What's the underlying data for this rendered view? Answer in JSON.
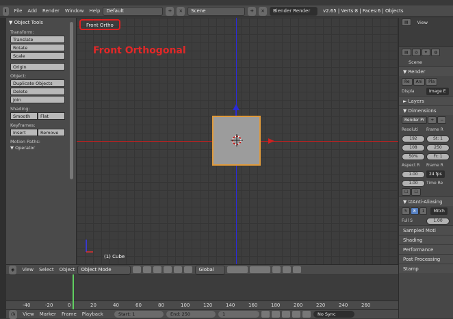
{
  "topbar": {
    "editor_icon": "ℹ",
    "menus": [
      "File",
      "Add",
      "Render",
      "Window",
      "Help"
    ],
    "layout": "Default",
    "scene": "Scene",
    "engine": "Blender Render",
    "stats": "v2.65 | Verts:8 | Faces:6 | Objects"
  },
  "toolshelf": {
    "title": "▼ Object Tools",
    "transform_label": "Transform:",
    "translate": "Translate",
    "rotate": "Rotate",
    "scale": "Scale",
    "origin": "Origin",
    "object_label": "Object:",
    "duplicate": "Duplicate Objects",
    "delete": "Delete",
    "join": "Join",
    "shading_label": "Shading:",
    "smooth": "Smooth",
    "flat": "Flat",
    "keyframes_label": "Keyframes:",
    "insert": "Insert",
    "remove": "Remove",
    "motion_paths": "Motion Paths:",
    "operator": "▼ Operator"
  },
  "viewport": {
    "view_label": "Front Ortho",
    "annotation": "Front Orthogonal",
    "object_label": "(1) Cube"
  },
  "props": {
    "view": "View",
    "scene": "Scene",
    "render": "▼ Render",
    "render_btns": [
      "Re",
      "Ani",
      "Pla"
    ],
    "display": "Displa",
    "display_val": "Image E",
    "layers": "► Layers",
    "dimensions": "▼ Dimensions",
    "preset": "Render Pr",
    "resolution": "Resoluti",
    "frame_range": "Frame R",
    "res_x": "192",
    "res_y": "108",
    "res_pct": "50%",
    "start": "St: 1",
    "end": "250",
    "frame_step": "Fr: 1",
    "aspect": "Aspect R",
    "frame_rate": "Frame R",
    "aspect_x": "1.00",
    "aspect_y": "1.00",
    "fps": "24 fps",
    "time_remap": "Time Re",
    "anti_aliasing": "Anti-Aliasing",
    "aa_vals": [
      "5",
      "8",
      "1"
    ],
    "mitch": "Mitch",
    "full": "Full S",
    "full_val": "1.00",
    "sampled": "Sampled Moti",
    "shading": "Shading",
    "performance": "Performance",
    "post": "Post Processing",
    "stamp": "Stamp"
  },
  "timeline_header": {
    "menus": [
      "View",
      "Select",
      "Object"
    ],
    "mode": "Object Mode",
    "orientation": "Global"
  },
  "timeline": {
    "ticks": [
      "-40",
      "-20",
      "0",
      "20",
      "40",
      "60",
      "80",
      "100",
      "120",
      "140",
      "160",
      "180",
      "200",
      "220",
      "240",
      "260"
    ],
    "current_frame": 1
  },
  "bottombar": {
    "menus": [
      "View",
      "Marker",
      "Frame",
      "Playback"
    ],
    "start": "Start: 1",
    "end": "End: 250",
    "current": "1",
    "sync": "No Sync"
  }
}
